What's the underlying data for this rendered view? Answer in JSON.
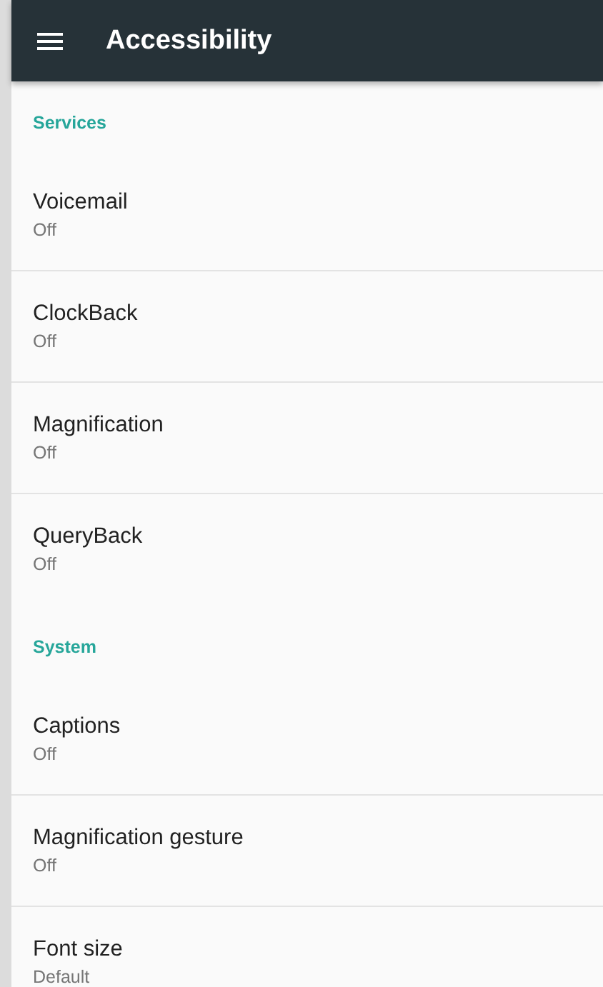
{
  "app_bar": {
    "title": "Accessibility"
  },
  "sections": [
    {
      "header": "Services",
      "items": [
        {
          "title": "Voicemail",
          "summary": "Off"
        },
        {
          "title": "ClockBack",
          "summary": "Off"
        },
        {
          "title": "Magnification",
          "summary": "Off"
        },
        {
          "title": "QueryBack",
          "summary": "Off"
        }
      ]
    },
    {
      "header": "System",
      "items": [
        {
          "title": "Captions",
          "summary": "Off"
        },
        {
          "title": "Magnification gesture",
          "summary": "Off"
        },
        {
          "title": "Font size",
          "summary": "Default"
        }
      ]
    }
  ]
}
